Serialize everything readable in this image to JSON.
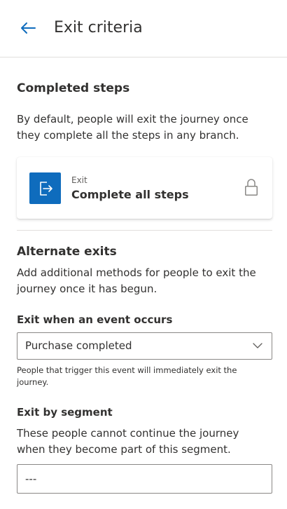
{
  "header": {
    "title": "Exit criteria",
    "back_icon": "arrow-left-icon"
  },
  "completed": {
    "title": "Completed steps",
    "description": "By default, people will exit the journey once they complete all the steps in any branch.",
    "card": {
      "small_label": "Exit",
      "main_label": "Complete all steps",
      "icon": "exit-icon",
      "lock_icon": "lock-icon",
      "icon_color": "#0f6cbd"
    }
  },
  "alternate": {
    "title": "Alternate exits",
    "description": "Add additional methods for people to exit the journey once it has begun."
  },
  "event": {
    "label": "Exit when an event occurs",
    "selected": "Purchase completed",
    "help": "People that trigger this event will immediately exit the journey."
  },
  "segment": {
    "label": "Exit by segment",
    "description": "These people cannot continue the journey when they become part of this segment.",
    "value": "---"
  },
  "colors": {
    "accent": "#0f6cbd",
    "text": "#323130",
    "border": "#8a8886"
  }
}
